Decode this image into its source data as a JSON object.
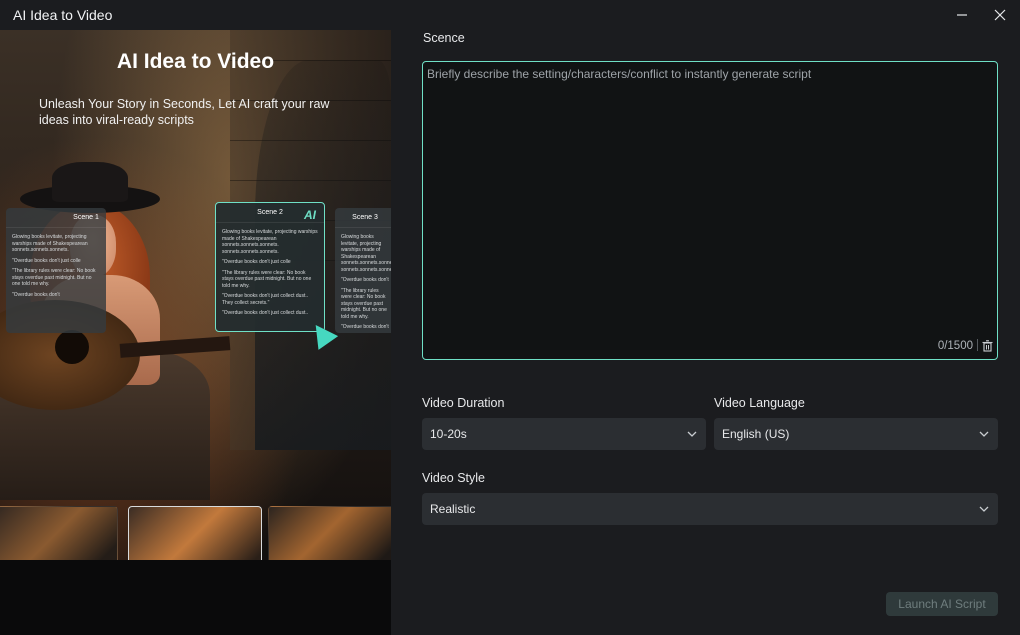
{
  "window": {
    "title": "AI Idea to Video"
  },
  "hero": {
    "title": "AI Idea to Video",
    "subtitle": "Unleash Your Story in Seconds,  Let AI craft your raw ideas into viral-ready scripts",
    "cards": [
      {
        "heading": "Scene 1",
        "lines": [
          "Glowing books levitate, projecting warships made of Shakespearean sonnets.sonnets.sonnets.",
          "\"Overdue books don't just colle",
          "\"The library rules were clear: No book stays overdue past midnight. But no one told me why.",
          "\"Overdue books don't"
        ]
      },
      {
        "heading": "Scene 2",
        "badge": "AI",
        "lines": [
          "Glowing books levitate, projecting warships made of Shakespearean sonnets.sonnets.sonnets. sonnets.sonnets.sonnets.",
          "\"Overdue books don't just colle",
          "\"The library rules were clear: No book stays overdue past midnight. But no one told me why.",
          "\"Overdue books don't just collect dust.. They collect secrets.\"",
          "\"Overdue books don't just collect dust.."
        ]
      },
      {
        "heading": "Scene 3",
        "lines": [
          "Glowing books levitate, projecting warships made of Shakespearean sonnets.sonnets.sonnets. sonnets.sonnets.sonnets.",
          "\"Overdue books don't",
          "\"The library rules were clear: No book stays overdue past midnight. But no one told me why.",
          "\"Overdue books don't"
        ]
      }
    ]
  },
  "form": {
    "scene_label": "Scence",
    "scene_placeholder": "Briefly describe the setting/characters/conflict to instantly generate script",
    "scene_value": "",
    "char_counter": "0/1500",
    "duration_label": "Video Duration",
    "duration_value": "10-20s",
    "language_label": "Video Language",
    "language_value": "English (US)",
    "style_label": "Video Style",
    "style_value": "Realistic",
    "launch_label": "Launch AI Script"
  },
  "colors": {
    "accent": "#6fe0c6",
    "background": "#1b1c1f",
    "field": "#2b2e32"
  },
  "icons": {
    "minimize": "minimize-icon",
    "close": "close-icon",
    "trash": "trash-icon",
    "chevron": "chevron-down-icon",
    "cursor": "cursor-arrow-icon"
  }
}
